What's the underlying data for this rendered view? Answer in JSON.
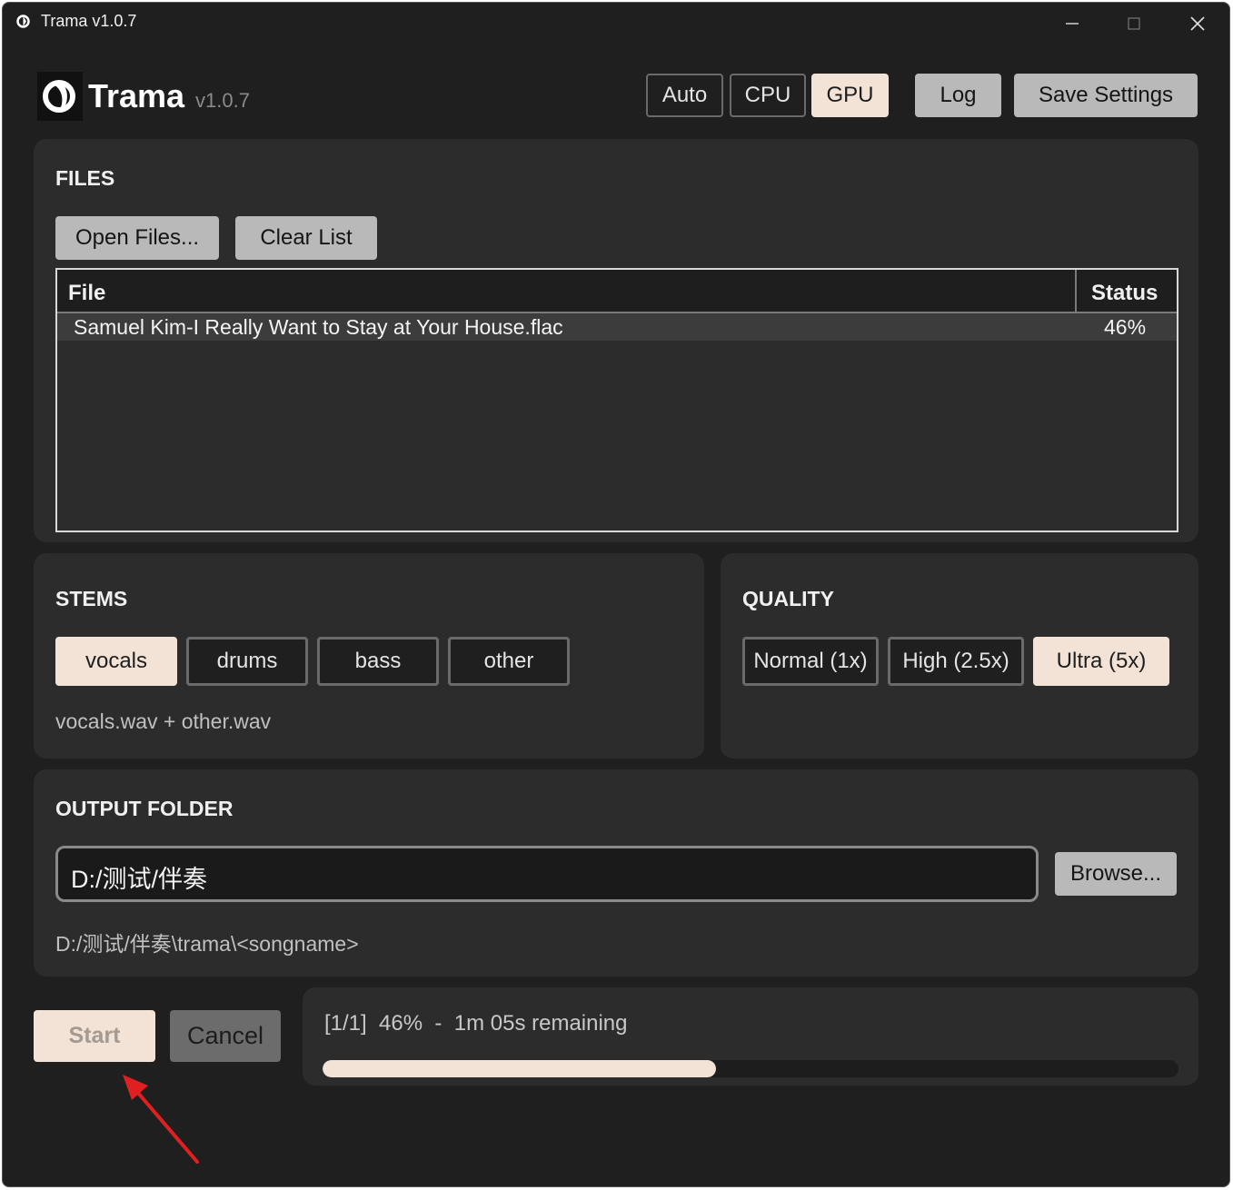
{
  "window": {
    "title": "Trama v1.0.7",
    "controls": {
      "minimize": "—",
      "maximize": "☐",
      "close": "✕"
    }
  },
  "header": {
    "app_name": "Trama",
    "version": "v1.0.7",
    "device_options": [
      {
        "label": "Auto",
        "selected": false
      },
      {
        "label": "CPU",
        "selected": false
      },
      {
        "label": "GPU",
        "selected": true
      }
    ],
    "log_label": "Log",
    "save_settings_label": "Save Settings"
  },
  "files": {
    "title": "FILES",
    "open_files_label": "Open Files...",
    "clear_list_label": "Clear List",
    "columns": [
      "File",
      "Status"
    ],
    "rows": [
      {
        "file": "Samuel Kim-I Really Want to Stay at Your House.flac",
        "status": "46%"
      }
    ]
  },
  "stems": {
    "title": "STEMS",
    "options": [
      {
        "label": "vocals",
        "selected": true
      },
      {
        "label": "drums",
        "selected": false
      },
      {
        "label": "bass",
        "selected": false
      },
      {
        "label": "other",
        "selected": false
      }
    ],
    "output_hint": "vocals.wav + other.wav"
  },
  "quality": {
    "title": "QUALITY",
    "options": [
      {
        "label": "Normal (1x)",
        "selected": false
      },
      {
        "label": "High (2.5x)",
        "selected": false
      },
      {
        "label": "Ultra (5x)",
        "selected": true
      }
    ]
  },
  "output": {
    "title": "OUTPUT FOLDER",
    "folder_value": "D:/测试/伴奏",
    "browse_label": "Browse...",
    "resolved_path": "D:/测试/伴奏\\trama\\<songname>"
  },
  "actions": {
    "start_label": "Start",
    "cancel_label": "Cancel"
  },
  "progress": {
    "status_text": "[1/1]  46%  -  1m 05s remaining",
    "percent": 46
  },
  "colors": {
    "accent": "#f3e3d6",
    "background": "#1f1f1f",
    "panel": "#2c2c2c",
    "annotation_arrow": "#e02020"
  }
}
